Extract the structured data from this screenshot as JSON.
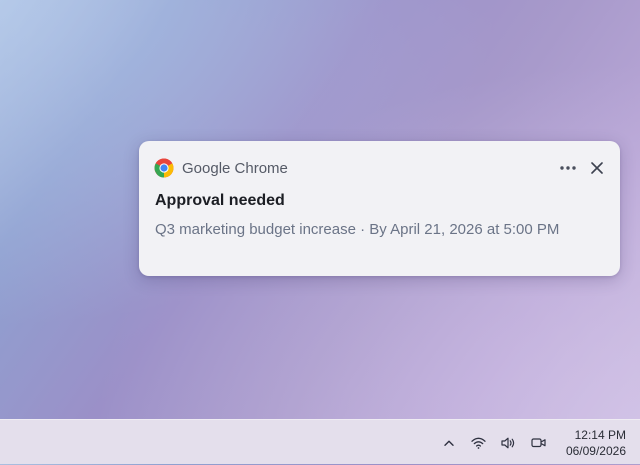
{
  "notification": {
    "app_icon": "chrome-icon",
    "app_name": "Google Chrome",
    "more_icon": "more-horizontal-icon",
    "close_icon": "close-icon",
    "title": "Approval needed",
    "body": "Q3 marketing budget increase · By April 21, 2026 at 5:00 PM"
  },
  "taskbar": {
    "tray_icons": [
      "chevron-up-icon",
      "wifi-icon",
      "volume-icon",
      "camera-icon"
    ],
    "clock": {
      "time": "12:14 PM",
      "date": "06/09/2026"
    }
  },
  "colors": {
    "toast_bg": "#f2f2f5",
    "title": "#1c1e24",
    "body_text": "#6b7487",
    "taskbar_bg": "#e4dfec"
  }
}
